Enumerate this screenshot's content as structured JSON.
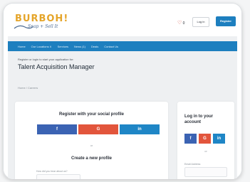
{
  "header": {
    "logo_text": "BURBOH!",
    "logo_tagline": "Snap + Sell It",
    "favorites_count": "0",
    "login_label": "Log in",
    "register_label": "Register"
  },
  "nav": {
    "items": [
      "Home",
      "Our Locations ∨",
      "Services",
      "News (1)",
      "Deals",
      "Contact Us"
    ]
  },
  "page": {
    "subtitle": "Register or login to start your application for:",
    "job_title": "Talent Acquisition Manager",
    "breadcrumb": "Home  /  Careers"
  },
  "social_register": {
    "heading": "Register with your social profile",
    "facebook": "f",
    "google": "G",
    "linkedin": "in",
    "or": "or",
    "create_heading": "Create a new profile",
    "field_label": "How did you hear about us?"
  },
  "login_panel": {
    "heading": "Log in to your account",
    "facebook": "f",
    "google": "G",
    "linkedin": "in",
    "or": "or",
    "email_label": "Email Address"
  },
  "colors": {
    "brand_blue": "#1d7fbf",
    "logo_orange": "#e5a52a",
    "facebook": "#3b63b3",
    "google": "#e2553c",
    "linkedin": "#1f86c6"
  }
}
